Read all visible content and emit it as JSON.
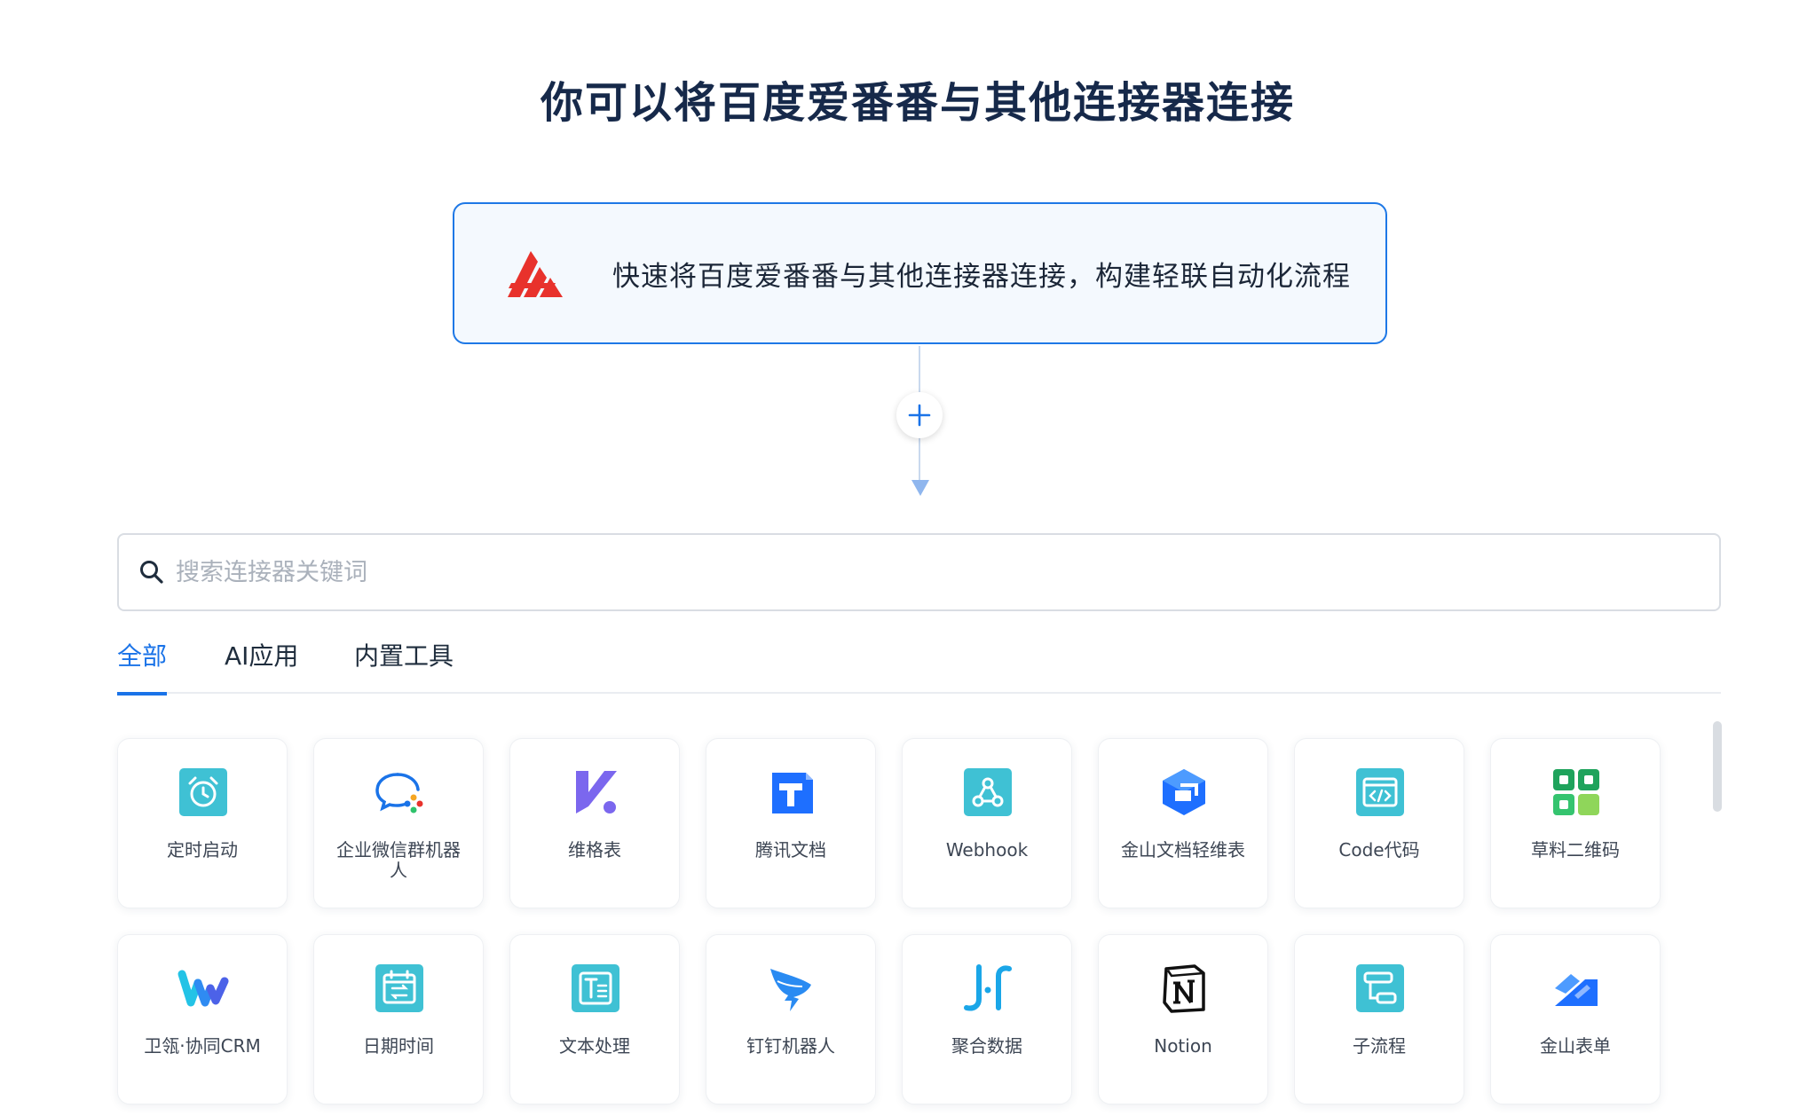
{
  "title": "你可以将百度爱番番与其他连接器连接",
  "trigger": {
    "text": "快速将百度爱番番与其他连接器连接，构建轻联自动化流程",
    "logo": "aifanfan-logo",
    "accent_color": "#e8322c"
  },
  "add_step": {
    "icon": "plus-icon"
  },
  "search": {
    "placeholder": "搜索连接器关键词",
    "value": ""
  },
  "tabs": [
    {
      "label": "全部",
      "active": true
    },
    {
      "label": "AI应用",
      "active": false
    },
    {
      "label": "内置工具",
      "active": false
    }
  ],
  "connectors": [
    {
      "label": "定时启动",
      "icon": "alarm-clock-icon"
    },
    {
      "label": "企业微信群机器人",
      "icon": "wecom-bot-icon"
    },
    {
      "label": "维格表",
      "icon": "vika-icon"
    },
    {
      "label": "腾讯文档",
      "icon": "tencent-docs-icon"
    },
    {
      "label": "Webhook",
      "icon": "webhook-icon"
    },
    {
      "label": "金山文档轻维表",
      "icon": "kdocs-sheet-icon"
    },
    {
      "label": "Code代码",
      "icon": "code-icon"
    },
    {
      "label": "草料二维码",
      "icon": "qr-code-icon"
    },
    {
      "label": "卫瓴·协同CRM",
      "icon": "weiling-crm-icon"
    },
    {
      "label": "日期时间",
      "icon": "calendar-icon"
    },
    {
      "label": "文本处理",
      "icon": "text-processing-icon"
    },
    {
      "label": "钉钉机器人",
      "icon": "dingtalk-icon"
    },
    {
      "label": "聚合数据",
      "icon": "juhe-data-icon"
    },
    {
      "label": "Notion",
      "icon": "notion-icon"
    },
    {
      "label": "子流程",
      "icon": "subflow-icon"
    },
    {
      "label": "金山表单",
      "icon": "kdocs-form-icon"
    }
  ],
  "colors": {
    "primary": "#1a73e8",
    "title": "#16294a",
    "card_border": "#eef0f3"
  }
}
